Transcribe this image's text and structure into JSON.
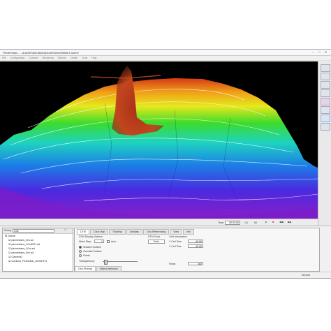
{
  "window": {
    "title": "Fledermaus - ...aracr/Explorations/plumeScene/folder1.scene",
    "controls": [
      "–",
      "□",
      "✕"
    ]
  },
  "menu": [
    "File",
    "Configuration",
    "Controls",
    "Rendering",
    "Objects",
    "Create",
    "Tools",
    "Help"
  ],
  "viewport": {
    "colors": {
      "background": "#000000",
      "plume": "#b8321e",
      "contour": "#ffffff"
    },
    "status": {
      "time_label": "Time:",
      "time_value": "00:00:00",
      "speed": "1.0",
      "fps": "60"
    }
  },
  "explorer": {
    "header": "Group",
    "search_placeholder": "Link",
    "items": [
      "Scene",
      "plumetrans_5m.sd",
      "plumetrans_40m5TH.sd",
      "plumetrans_10m.sd",
      "plumetrans_5m.sd",
      "Camera1",
      "Contour_PlumeDis_40m5TH1"
    ]
  },
  "properties": {
    "tabs": [
      "DTM",
      "Color Map",
      "Shading",
      "Analysis",
      "Geo-Referencing",
      "View",
      "Info"
    ],
    "active_tab": "DTM",
    "dtm_display_options": "DTM Display Options",
    "mesh_step_label": "Mesh Step:",
    "mesh_step_value": "1",
    "auto_label": "Auto",
    "shaded_surface": "Shaded Surface",
    "draped_surface": "Overlaid Surface",
    "points": "Points",
    "transparency": "Transparency:",
    "dtm_tools": "DTM Tools",
    "tools_btn": "Tools",
    "grid_information": "Grid Information",
    "xcell_label": "X Cell Size:",
    "xcell_value": "40.00",
    "ycell_label": "Y Cell Size:",
    "ycell_value": "40.00",
    "rows_label": "Rows:",
    "rows_value": "182",
    "bottom_tabs": [
      "Geo-Picking",
      "Object Attributes"
    ]
  },
  "status_text": "Normal"
}
